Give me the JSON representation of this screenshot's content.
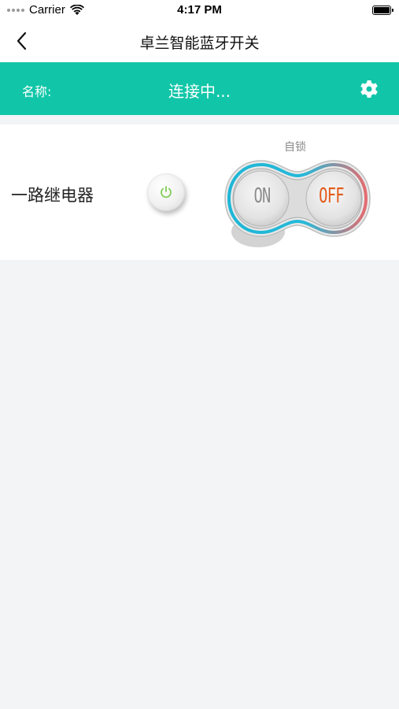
{
  "status_bar": {
    "carrier": "Carrier",
    "time": "4:17 PM"
  },
  "nav": {
    "title": "卓兰智能蓝牙开关"
  },
  "device_header": {
    "name_label": "名称:",
    "connection_status": "连接中...",
    "background_color": "#11c6a8"
  },
  "relay": {
    "label": "一路继电器",
    "mode_label": "自锁",
    "on_label": "ON",
    "off_label": "OFF",
    "off_color": "#e35a1a",
    "state": "OFF"
  },
  "icons": {
    "back": "chevron-left-icon",
    "settings": "gear-icon",
    "power": "power-icon",
    "wifi": "wifi-icon",
    "battery": "battery-icon"
  }
}
